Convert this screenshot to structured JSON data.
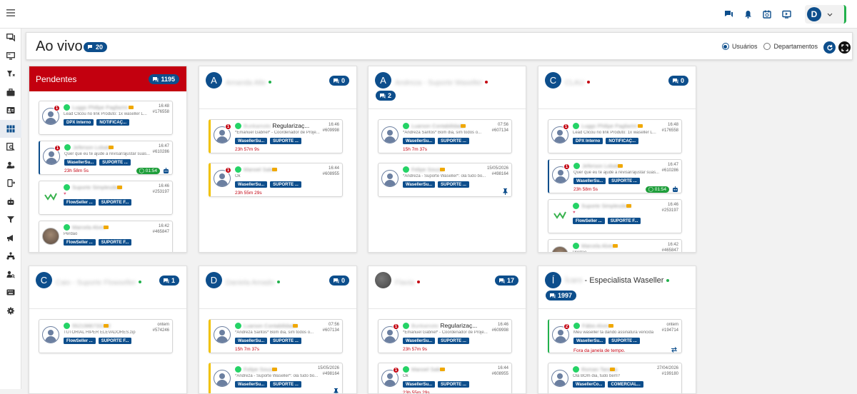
{
  "header": {
    "title": "Ao vivo",
    "count": "20",
    "radio_users": "Usuários",
    "radio_depts": "Departamentos"
  },
  "topbar": {
    "avatar_initial": "D"
  },
  "colors": {
    "brand": "#0d4e8c",
    "pendentes": "#c3000f",
    "whatsapp": "#25d366",
    "timer_green": "#1e9e3a"
  },
  "panels": [
    {
      "title": "Pendentes",
      "count": "1195",
      "cards": [
        {
          "name": "Luggs Philipe Pagliarini",
          "time": "16:48",
          "id": "#176558",
          "msg": "Lead Clicou no link Produto: 1x waseller L...",
          "chips": [
            "DPX Interno",
            "NOTIFICAÇ..."
          ],
          "unread": "1"
        },
        {
          "name": "Jeferson Lobato",
          "time": "16:47",
          "id": "#610286",
          "msg": "Quer que eu te ajude a revisar/ajustar suas...",
          "chips": [
            "WasellerSu...",
            "SUPORTE ..."
          ],
          "unread": "1",
          "timer": "23h 58m 5s",
          "green": "01:54"
        },
        {
          "name": "Suporte Simplesdeal",
          "time": "16:46",
          "id": "#253197",
          "msg": "",
          "chips": [
            "FlowSeller ...",
            "SUPORTE F..."
          ]
        },
        {
          "name": "Marcela Alves",
          "time": "16:42",
          "id": "#465847",
          "msg": "Perdão",
          "chips": [
            "FlowSeller ...",
            "SUPORTE F..."
          ]
        }
      ]
    },
    {
      "initial": "A",
      "name": "Amanda Alle",
      "count": "0",
      "cards": [
        {
          "name": "Bunkamoto",
          "suffix": "Regularizaç...",
          "time": "16:46",
          "id": "#609998",
          "msg": "*Emanuel Gabriel* - Coordenador de Proje...",
          "chips": [
            "WasellerSu...",
            "SUPORTE ..."
          ],
          "unread": "1",
          "timer": "23h 57m 9s"
        },
        {
          "name": "Manoel Sales",
          "time": "16:44",
          "id": "#608955",
          "msg": "Ok",
          "chips": [
            "WasellerSu...",
            "SUPORTE ..."
          ],
          "unread": "1",
          "timer": "23h 55m 29s"
        }
      ]
    },
    {
      "initial": "A",
      "name": "Andreza - Suporte Waseller",
      "count": "2",
      "cards": [
        {
          "name": "Luarson Contabilidade",
          "time": "07:56",
          "id": "#607134",
          "msg": "*Andreza Santos* Bom dia, sim todos o...",
          "chips": [
            "WasellerSu...",
            "SUPORTE ..."
          ],
          "timer": "15h 7m 37s"
        },
        {
          "name": "Felipe Souza",
          "time": "15/05/2026",
          "id": "#498164",
          "msg": "*Andreza - Suporte Waseller*: olá tudo bo...",
          "chips": [
            "WasellerSu...",
            "SUPORTE ..."
          ]
        }
      ]
    },
    {
      "initial": "C",
      "name": "CLAU",
      "count": "0",
      "cards": [
        {
          "name": "Luggs Philipe Pagliarini",
          "time": "16:48",
          "id": "#176558",
          "msg": "Lead Clicou no link Produto: 1x waseller L...",
          "chips": [
            "DPX Interno",
            "NOTIFICAÇ..."
          ],
          "unread": "1"
        },
        {
          "name": "Jeferson Lobato",
          "time": "16:47",
          "id": "#610286",
          "msg": "Quer que eu te ajude a revisar/ajustar suas...",
          "chips": [
            "WasellerSu...",
            "SUPORTE ..."
          ],
          "unread": "1",
          "timer": "23h 58m 5s",
          "green": "01:54"
        },
        {
          "name": "Suporte Simplesdeal",
          "time": "16:46",
          "id": "#253197",
          "msg": "",
          "chips": [
            "FlowSeller ...",
            "SUPORTE F..."
          ]
        },
        {
          "name": "Marcela Alves",
          "time": "16:42",
          "id": "#465847",
          "msg": "Perdão",
          "chips": [
            "FlowSeller ...",
            "SUPORTE F..."
          ]
        }
      ]
    },
    {
      "initial": "C",
      "name": "Caio - Suporte Flowseller",
      "count": "1",
      "cards": [
        {
          "name": "5521986733142",
          "time": "ontem",
          "id": "#574246",
          "msg": "TUTORIAL HIPER ELEVADORES.zip",
          "chips": [
            "FlowSeller ...",
            "SUPORTE F..."
          ]
        }
      ]
    },
    {
      "initial": "D",
      "name": "Daniela Amado",
      "count": "0",
      "cards": [
        {
          "name": "Luarson Contabilidade",
          "time": "07:56",
          "id": "#607134",
          "msg": "*Andreza Santos* Bom dia, sim todos o...",
          "chips": [
            "WasellerSu...",
            "SUPORTE ..."
          ],
          "timer": "15h 7m 37s"
        },
        {
          "name": "Felipe Souza",
          "time": "15/05/2026",
          "id": "#498164",
          "msg": "*Andreza - Suporte Waseller*: olá tudo bo...",
          "chips": [
            "WasellerSu...",
            "SUPORTE ..."
          ]
        }
      ]
    },
    {
      "name": "Flavia",
      "count": "17",
      "cards": [
        {
          "name": "Bunkamoto",
          "suffix": "Regularizaç...",
          "time": "16:46",
          "id": "#609998",
          "msg": "*Emanuel Gabriel* - Coordenador de Proje...",
          "chips": [
            "WasellerSu...",
            "SUPORTE ..."
          ],
          "unread": "1",
          "timer": "23h 57m 9s"
        },
        {
          "name": "Manoel Sales",
          "time": "16:44",
          "id": "#608955",
          "msg": "Ok",
          "chips": [
            "WasellerSu...",
            "SUPORTE ..."
          ],
          "unread": "1",
          "timer": "23h 55m 29s"
        }
      ]
    },
    {
      "initial": "Í",
      "name": "Ícaro",
      "suffix": " - Especialista Waseller",
      "count": "1997",
      "cards": [
        {
          "name": "Fábio Alves",
          "time": "ontem",
          "id": "#194714",
          "msg": "Meu waseller ta dando assinatura vencida",
          "chips": [
            "WasellerSu...",
            "SUPORTE ..."
          ],
          "unread": "2",
          "timer": "Fora da janela de tempo."
        },
        {
          "name": "Roman Tanaka",
          "time": "27/04/2026",
          "id": "#199180",
          "msg": "Olá BOm dia, tudo bem?",
          "chips": [
            "WasellerCo...",
            "COMERCIAL..."
          ]
        }
      ]
    }
  ]
}
